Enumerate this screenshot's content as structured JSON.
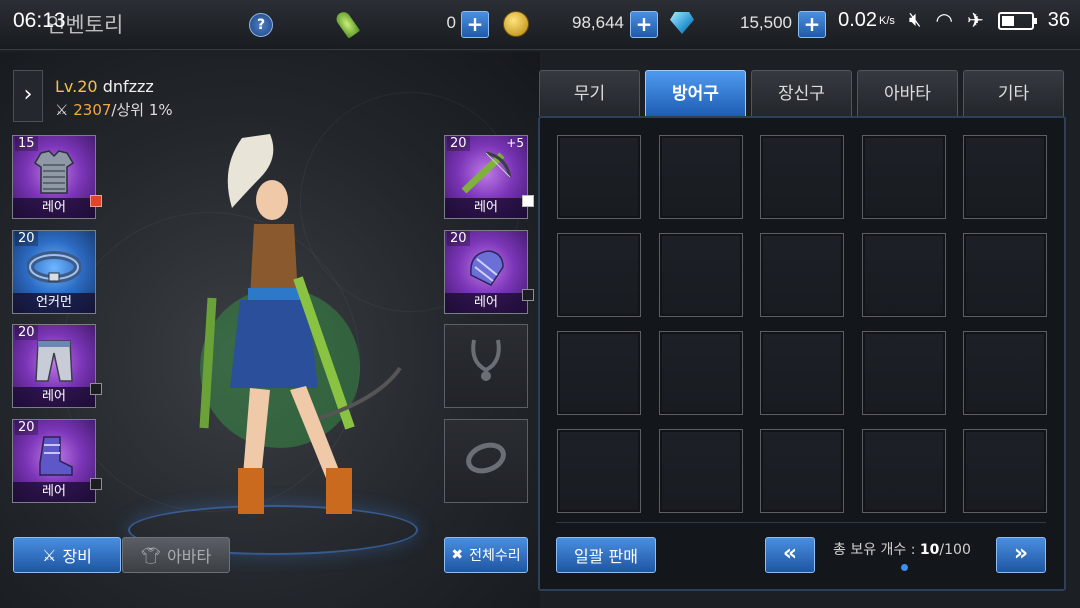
{
  "status_bar": {
    "time": "06:13",
    "speed": "0.02",
    "speed_unit": "K/s",
    "battery": "36"
  },
  "header": {
    "title": "인벤토리",
    "help_label": "?",
    "resources": [
      {
        "name": "key",
        "icon": "key-icon",
        "value": "0"
      },
      {
        "name": "gold",
        "icon": "coin-icon",
        "value": "98,644"
      },
      {
        "name": "gem",
        "icon": "gem-icon",
        "value": "15,500"
      }
    ],
    "plus_label": "+"
  },
  "character": {
    "level_prefix": "Lv.",
    "level": "20",
    "name": "dnfzzz",
    "power": "2307",
    "rank": "/상위 1%"
  },
  "equipment_left": [
    {
      "slot": "armor",
      "icon": "chainmail-armor-icon",
      "level": "15",
      "grade": "레어",
      "rarity": "rare",
      "checked": "red"
    },
    {
      "slot": "belt",
      "icon": "belt-icon",
      "level": "20",
      "grade": "언커먼",
      "rarity": "uncommon",
      "checked": "none"
    },
    {
      "slot": "pants",
      "icon": "pants-icon",
      "level": "20",
      "grade": "레어",
      "rarity": "rare",
      "checked": "off"
    },
    {
      "slot": "boots",
      "icon": "boots-icon",
      "level": "20",
      "grade": "레어",
      "rarity": "rare",
      "checked": "off"
    }
  ],
  "equipment_right": [
    {
      "slot": "weapon",
      "icon": "crossbow-icon",
      "level": "20",
      "plus": "+5",
      "grade": "레어",
      "rarity": "rare",
      "checked": "white"
    },
    {
      "slot": "shoulder",
      "icon": "shoulder-armor-icon",
      "level": "20",
      "grade": "레어",
      "rarity": "rare",
      "checked": "off"
    },
    {
      "slot": "necklace",
      "icon": "necklace-icon",
      "empty": true
    },
    {
      "slot": "ring",
      "icon": "ring-icon",
      "empty": true
    }
  ],
  "buttons": {
    "equip": "장비",
    "avatar": "아바타",
    "repair_all": "전체수리",
    "bulk_sell": "일괄 판매"
  },
  "tabs": [
    {
      "label": "무기",
      "active": false
    },
    {
      "label": "방어구",
      "active": true
    },
    {
      "label": "장신구",
      "active": false
    },
    {
      "label": "아바타",
      "active": false
    },
    {
      "label": "기타",
      "active": false
    }
  ],
  "inventory": {
    "rows": 4,
    "cols": 5,
    "count_label": "총 보유 개수 : ",
    "count_current": "10",
    "count_max": "/100",
    "prev_label": "«",
    "next_label": "»"
  },
  "colors": {
    "accent": "#2f78d8",
    "rare": "#8a3fc8",
    "uncommon": "#2d6cc4",
    "gold_text": "#f5c342"
  }
}
